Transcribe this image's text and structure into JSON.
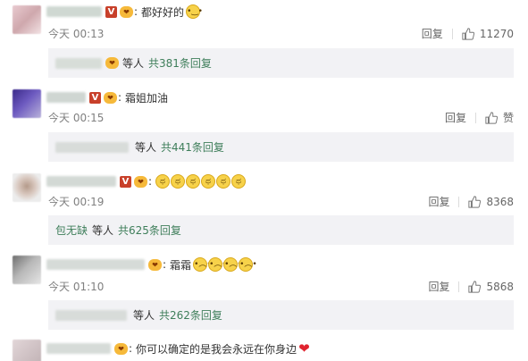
{
  "comments": [
    {
      "text": "都好好的",
      "time": "今天 00:13",
      "reply_label": "回复",
      "like_count": "11270",
      "reply_summary": {
        "others": "等人",
        "count_text": "共381条回复"
      }
    },
    {
      "text": "霜姐加油",
      "time": "今天 00:15",
      "reply_label": "回复",
      "like_count": "赞",
      "reply_summary": {
        "others": "等人",
        "count_text": "共441条回复"
      }
    },
    {
      "text": "",
      "time": "今天 00:19",
      "reply_label": "回复",
      "like_count": "8368",
      "reply_summary": {
        "first_name": "包无缺",
        "others": "等人",
        "count_text": "共625条回复"
      }
    },
    {
      "text": "霜霜",
      "time": "今天 01:10",
      "reply_label": "回复",
      "like_count": "5868",
      "reply_summary": {
        "others": "等人",
        "count_text": "共262条回复"
      }
    },
    {
      "text": "你可以确定的是我会永远在你身边"
    }
  ],
  "icons": {
    "verified": "V",
    "fan_badge": "fan-badge-icon",
    "thumb_up": "thumb-up-icon",
    "heart": "❤"
  },
  "colors": {
    "link": "#3e7e5a",
    "verified": "#c8402a",
    "reply_bg": "#f2f2f5",
    "timestamp": "#808080"
  }
}
